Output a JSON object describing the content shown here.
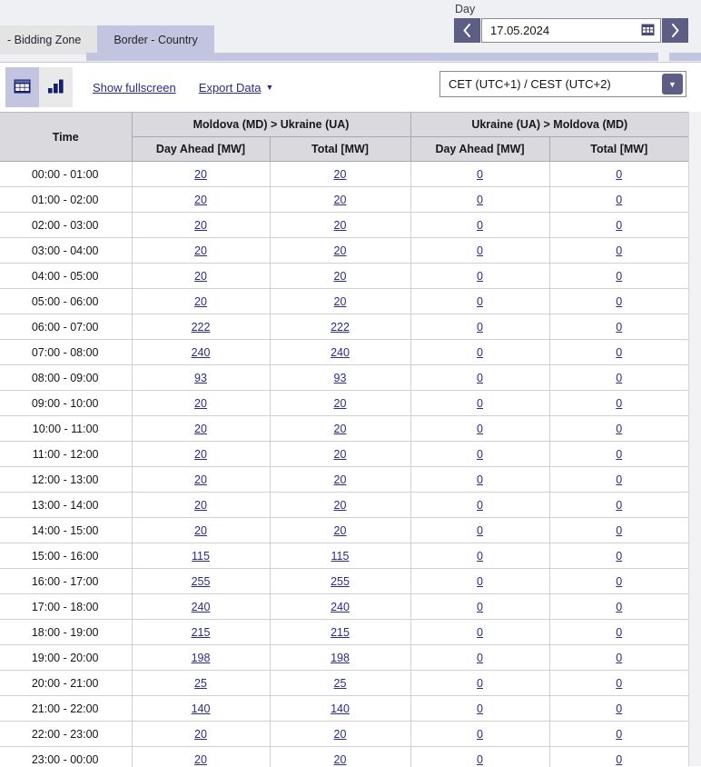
{
  "tabs": [
    {
      "label": "- Bidding Zone",
      "active": false
    },
    {
      "label": "Border - Country",
      "active": true
    }
  ],
  "day_picker": {
    "label": "Day",
    "prev_icon": "chevron-left-icon",
    "next_icon": "chevron-right-icon",
    "date_value": "17.05.2024",
    "calendar_icon": "calendar-icon"
  },
  "toolbar": {
    "table_view_icon": "table-view-icon",
    "chart_view_icon": "bar-chart-view-icon",
    "fullscreen_label": "Show fullscreen",
    "export_label": "Export Data",
    "export_caret": "▼",
    "timezone_value": "CET (UTC+1) / CEST (UTC+2)",
    "timezone_arrow": "▼"
  },
  "colors": {
    "accent_purple": "#5d5d86",
    "tab_active": "#c3c4e0",
    "link_blue": "#2a2a8c",
    "header_gray": "#d9d9de"
  },
  "table": {
    "time_header": "Time",
    "groups": [
      {
        "label": "Moldova (MD) > Ukraine (UA)",
        "sub": [
          "Day Ahead [MW]",
          "Total [MW]"
        ]
      },
      {
        "label": "Ukraine (UA) > Moldova (MD)",
        "sub": [
          "Day Ahead [MW]",
          "Total [MW]"
        ]
      }
    ],
    "rows": [
      {
        "time": "00:00 - 01:00",
        "values": [
          "20",
          "20",
          "0",
          "0"
        ]
      },
      {
        "time": "01:00 - 02:00",
        "values": [
          "20",
          "20",
          "0",
          "0"
        ]
      },
      {
        "time": "02:00 - 03:00",
        "values": [
          "20",
          "20",
          "0",
          "0"
        ]
      },
      {
        "time": "03:00 - 04:00",
        "values": [
          "20",
          "20",
          "0",
          "0"
        ]
      },
      {
        "time": "04:00 - 05:00",
        "values": [
          "20",
          "20",
          "0",
          "0"
        ]
      },
      {
        "time": "05:00 - 06:00",
        "values": [
          "20",
          "20",
          "0",
          "0"
        ]
      },
      {
        "time": "06:00 - 07:00",
        "values": [
          "222",
          "222",
          "0",
          "0"
        ]
      },
      {
        "time": "07:00 - 08:00",
        "values": [
          "240",
          "240",
          "0",
          "0"
        ]
      },
      {
        "time": "08:00 - 09:00",
        "values": [
          "93",
          "93",
          "0",
          "0"
        ]
      },
      {
        "time": "09:00 - 10:00",
        "values": [
          "20",
          "20",
          "0",
          "0"
        ]
      },
      {
        "time": "10:00 - 11:00",
        "values": [
          "20",
          "20",
          "0",
          "0"
        ]
      },
      {
        "time": "11:00 - 12:00",
        "values": [
          "20",
          "20",
          "0",
          "0"
        ]
      },
      {
        "time": "12:00 - 13:00",
        "values": [
          "20",
          "20",
          "0",
          "0"
        ]
      },
      {
        "time": "13:00 - 14:00",
        "values": [
          "20",
          "20",
          "0",
          "0"
        ]
      },
      {
        "time": "14:00 - 15:00",
        "values": [
          "20",
          "20",
          "0",
          "0"
        ]
      },
      {
        "time": "15:00 - 16:00",
        "values": [
          "115",
          "115",
          "0",
          "0"
        ]
      },
      {
        "time": "16:00 - 17:00",
        "values": [
          "255",
          "255",
          "0",
          "0"
        ]
      },
      {
        "time": "17:00 - 18:00",
        "values": [
          "240",
          "240",
          "0",
          "0"
        ]
      },
      {
        "time": "18:00 - 19:00",
        "values": [
          "215",
          "215",
          "0",
          "0"
        ]
      },
      {
        "time": "19:00 - 20:00",
        "values": [
          "198",
          "198",
          "0",
          "0"
        ]
      },
      {
        "time": "20:00 - 21:00",
        "values": [
          "25",
          "25",
          "0",
          "0"
        ]
      },
      {
        "time": "21:00 - 22:00",
        "values": [
          "140",
          "140",
          "0",
          "0"
        ]
      },
      {
        "time": "22:00 - 23:00",
        "values": [
          "20",
          "20",
          "0",
          "0"
        ]
      },
      {
        "time": "23:00 - 00:00",
        "values": [
          "20",
          "20",
          "0",
          "0"
        ]
      }
    ]
  }
}
